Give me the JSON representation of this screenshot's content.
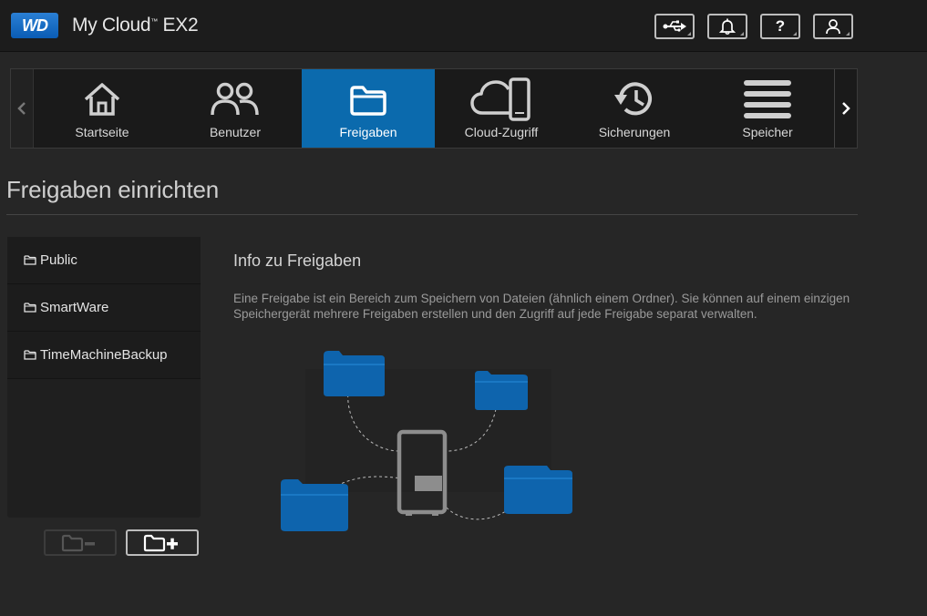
{
  "header": {
    "logo_text": "WD",
    "app_name": "My Cloud",
    "tm": "™",
    "model": "EX2",
    "icons": [
      "usb-icon",
      "bell-icon",
      "help-icon",
      "user-icon"
    ],
    "help_glyph": "?"
  },
  "nav": {
    "items": [
      {
        "label": "Startseite",
        "icon": "home-icon"
      },
      {
        "label": "Benutzer",
        "icon": "users-icon"
      },
      {
        "label": "Freigaben",
        "icon": "folder-icon"
      },
      {
        "label": "Cloud-Zugriff",
        "icon": "cloud-phone-icon"
      },
      {
        "label": "Sicherungen",
        "icon": "history-icon"
      },
      {
        "label": "Speicher",
        "icon": "storage-icon"
      }
    ],
    "active": "Freigaben"
  },
  "page": {
    "title": "Freigaben einrichten"
  },
  "shares": {
    "items": [
      "Public",
      "SmartWare",
      "TimeMachineBackup"
    ]
  },
  "info": {
    "title": "Info zu Freigaben",
    "text": "Eine Freigabe ist ein Bereich zum Speichern von Dateien (ähnlich einem Ordner). Sie können auf einem einzigen Speichergerät mehrere Freigaben erstellen und den Zugriff auf jede Freigabe separat verwalten."
  },
  "colors": {
    "accent": "#0b6aad",
    "folder_blue": "#0e64ad",
    "background": "#262626"
  }
}
